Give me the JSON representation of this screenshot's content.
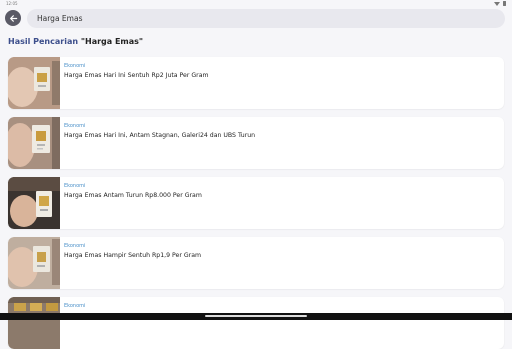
{
  "status_bar": {
    "time": "12:05"
  },
  "search": {
    "value": "Harga Emas"
  },
  "results": {
    "prefix": "Hasil Pencarian ",
    "query": "\"Harga Emas\"",
    "items": [
      {
        "category": "Ekonomi",
        "headline": "Harga Emas Hari Ini Sentuh Rp2 Juta Per Gram"
      },
      {
        "category": "Ekonomi",
        "headline": "Harga Emas Hari Ini, Antam Stagnan, Galeri24 dan UBS Turun"
      },
      {
        "category": "Ekonomi",
        "headline": "Harga Emas Antam Turun Rp8.000 Per Gram"
      },
      {
        "category": "Ekonomi",
        "headline": "Harga Emas Hampir Sentuh Rp1,9 Per Gram"
      },
      {
        "category": "Ekonomi",
        "headline": ""
      }
    ]
  },
  "colors": {
    "accent": "#3d4f8c",
    "category": "#4a90c9",
    "back_button": "#5a5a66"
  },
  "icons": {
    "back": "arrow-left-icon"
  }
}
